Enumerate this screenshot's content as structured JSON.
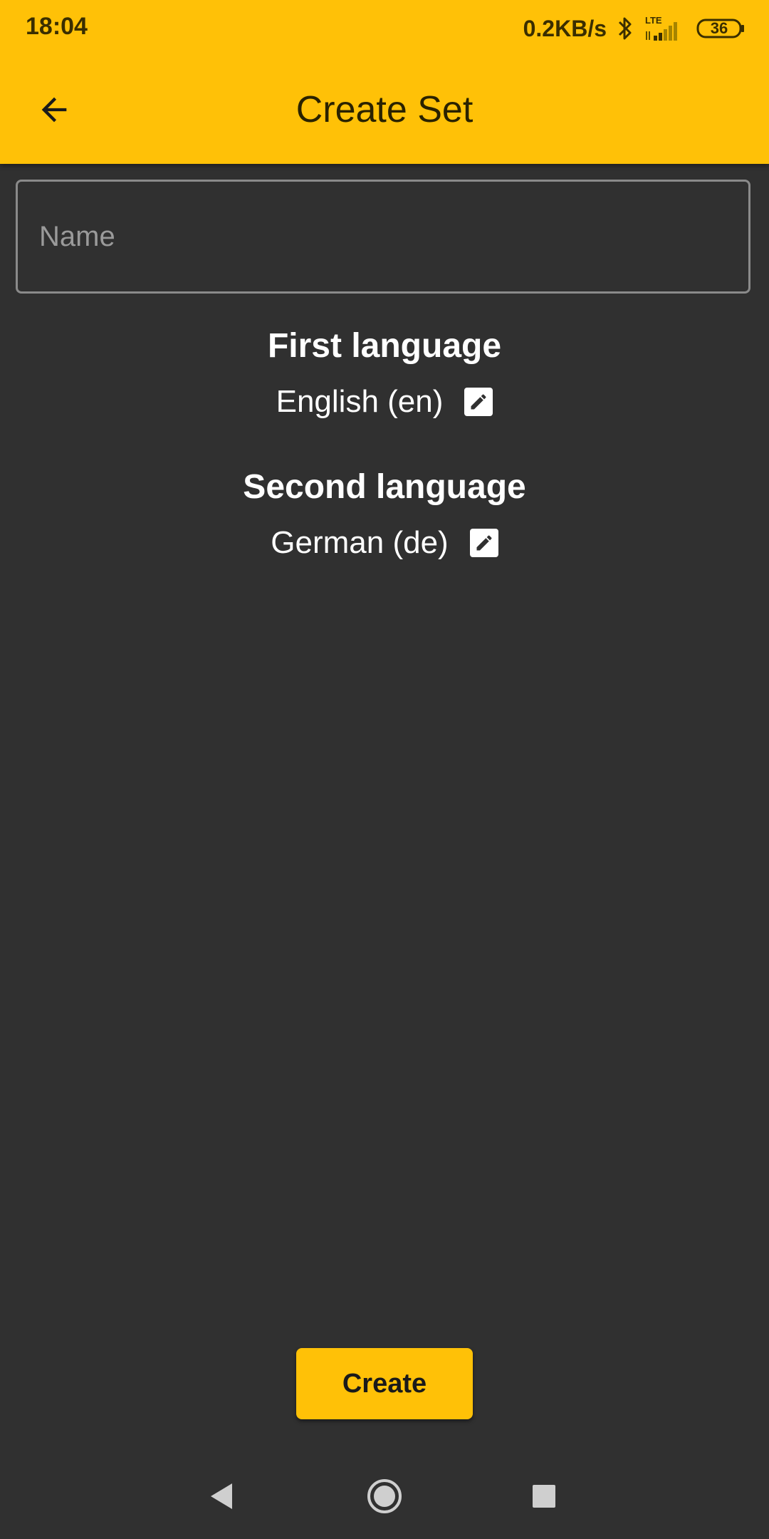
{
  "status_bar": {
    "time": "18:04",
    "net_speed": "0.2KB/s",
    "network_type": "LTE",
    "battery": "36",
    "icons": [
      "bluetooth-icon",
      "signal-icon",
      "battery-icon"
    ]
  },
  "app_bar": {
    "title": "Create Set",
    "back_icon": "arrow-left-icon",
    "background_color": "#FFC107"
  },
  "form": {
    "name_placeholder": "Name",
    "name_value": "",
    "first_language": {
      "label": "First language",
      "value": "English (en)",
      "edit_icon": "pencil-icon"
    },
    "second_language": {
      "label": "Second language",
      "value": "German (de)",
      "edit_icon": "pencil-icon"
    },
    "create_label": "Create"
  },
  "nav_bar": {
    "items": [
      "back-triangle-icon",
      "home-circle-icon",
      "recents-square-icon"
    ]
  },
  "colors": {
    "accent": "#FFC107",
    "background": "#303030",
    "text": "#FFFFFF"
  }
}
